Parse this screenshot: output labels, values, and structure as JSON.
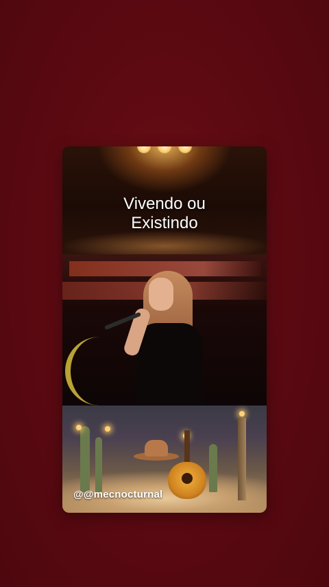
{
  "post": {
    "title_line1": "Vivendo ou",
    "title_line2": "Existindo",
    "handle": "@@mecnocturnal"
  },
  "colors": {
    "background": "#5c0a12",
    "title_text": "#ffffff",
    "handle_text": "#ffffff"
  },
  "images": {
    "stage": "stage-spotlight-image",
    "singer": "singer-microphone-photo",
    "scene": "desert-guitar-hat-scene"
  }
}
